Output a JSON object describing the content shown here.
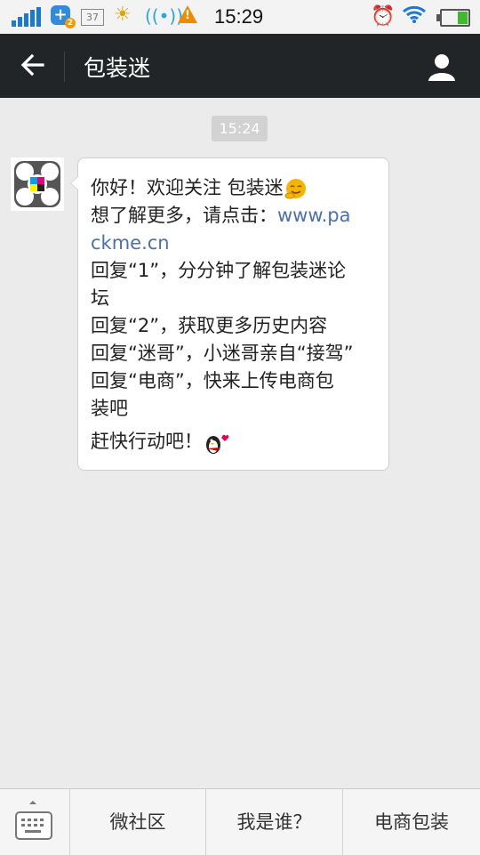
{
  "status_bar": {
    "time": "15:29",
    "temp_badge": "37",
    "notification_count": "2",
    "icons": [
      "signal-icon",
      "app-notification-icon",
      "temperature-icon",
      "weather-sun-icon",
      "radio-icon",
      "warning-icon",
      "alarm-icon",
      "wifi-icon",
      "battery-icon"
    ]
  },
  "header": {
    "title": "包装迷",
    "icons": [
      "back-arrow-icon",
      "person-icon"
    ]
  },
  "chat": {
    "timestamp": "15:24",
    "message": {
      "line1": "你好！欢迎关注 包装迷",
      "line2_prefix": "想了解更多，请点击：",
      "link_part1": "www.pa",
      "link_part2": "ckme.cn",
      "line4": "回复“1”，分分钟了解包装迷论",
      "line5": "坛",
      "line6": "回复“2”，获取更多历史内容",
      "line7": "回复“迷哥”，小迷哥亲自“接驾”",
      "line8": "回复“电商”，快来上传电商包",
      "line9": "装吧",
      "line10": "赶快行动吧！"
    }
  },
  "bottom_menu": {
    "items": [
      {
        "label": "微社区"
      },
      {
        "label": "我是谁？"
      },
      {
        "label": "电商包装"
      }
    ]
  },
  "colors": {
    "title_bar": "#212528",
    "background": "#ebebeb",
    "link": "#4a6fb3"
  }
}
